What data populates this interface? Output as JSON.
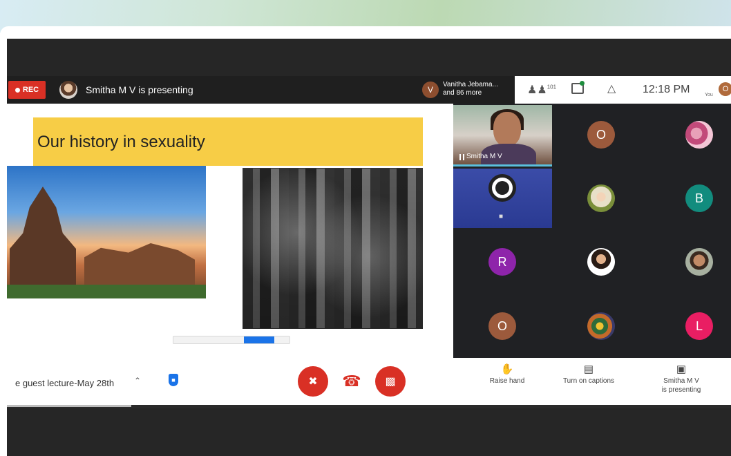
{
  "topbar": {
    "rec_label": "REC",
    "presenting_text": "Smitha M V is presenting",
    "viewer_initial": "V",
    "viewer_text": "Vanitha Jebama... and 86 more"
  },
  "meet_controls": {
    "people_icon": "people-icon",
    "people_count": "101",
    "chat_icon": "chat-icon",
    "activities_icon": "activities-icon",
    "time": "12:18 PM",
    "you_label": "You",
    "me_initial": "O"
  },
  "slide": {
    "title": "Our history in sexuality"
  },
  "participants": {
    "self_name": "Smitha M V",
    "avatars": [
      {
        "initial": "O",
        "color": "#9c5a3c"
      },
      {
        "initial": "B",
        "color": "#128c7e"
      },
      {
        "initial": "R",
        "color": "#8e24aa"
      },
      {
        "initial": "O",
        "color": "#9c5a3c"
      },
      {
        "initial": "L",
        "color": "#e91e63"
      }
    ]
  },
  "bottombar": {
    "meeting_name": "e guest lecture-May 28th",
    "mic_icon": "mic-off-icon",
    "end_call_icon": "end-call-icon",
    "cam_icon": "camera-off-icon",
    "raise_hand": "Raise hand",
    "captions": "Turn on captions",
    "presenting_line1": "Smitha M V",
    "presenting_line2": "is presenting"
  },
  "colors": {
    "rec_red": "#d93025",
    "accent_blue": "#1a73e8",
    "slide_title_bg": "#f7cd46",
    "grid_bg": "#202124",
    "active_speaker": "#5bc0de"
  }
}
